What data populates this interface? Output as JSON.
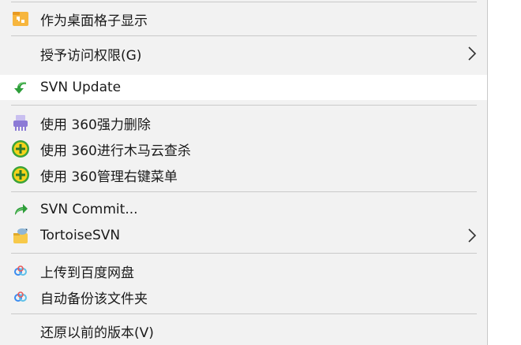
{
  "menu": {
    "items": [
      {
        "label": "作为桌面格子显示",
        "icon": "folder-grid-icon"
      },
      {
        "label": "授予访问权限(G)",
        "icon": "",
        "submenu": true
      },
      {
        "label": "SVN Update",
        "icon": "svn-update-icon"
      },
      {
        "label": "使用 360强力删除",
        "icon": "360-shredder-icon"
      },
      {
        "label": "使用 360进行木马云查杀",
        "icon": "360-scan-icon"
      },
      {
        "label": "使用 360管理右键菜单",
        "icon": "360-manage-icon"
      },
      {
        "label": "SVN Commit...",
        "icon": "svn-commit-icon"
      },
      {
        "label": "TortoiseSVN",
        "icon": "tortoisesvn-icon",
        "submenu": true
      },
      {
        "label": "上传到百度网盘",
        "icon": "baidu-netdisk-icon"
      },
      {
        "label": "自动备份该文件夹",
        "icon": "baidu-backup-icon"
      },
      {
        "label": "还原以前的版本(V)",
        "icon": ""
      }
    ]
  },
  "colors": {
    "menu_bg": "#f2f2f2",
    "hover_bg": "#ffffff",
    "separator": "#c9c9c9",
    "folder_orange": "#f7b63e",
    "svn_green": "#2e9e3a",
    "icon_360_yellow": "#f5d31a",
    "icon_360_green": "#3aa33a",
    "shredder_purple": "#8c7ad6",
    "baidu_blue": "#3a8cf0"
  }
}
